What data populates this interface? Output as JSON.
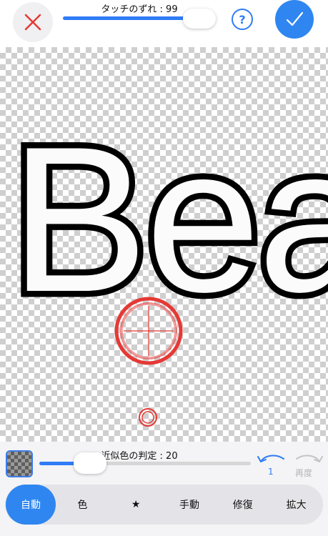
{
  "touch_offset": {
    "label": "タッチのずれ : 99",
    "value": 99,
    "max": 100
  },
  "help_label": "?",
  "canvas": {
    "text": "Bea"
  },
  "similarity": {
    "label": "近似色の判定 : 20",
    "value": 20,
    "max": 100
  },
  "history": {
    "undo_count": "1",
    "redo_label": "再度"
  },
  "tabs": [
    {
      "label": "自動",
      "active": true
    },
    {
      "label": "色",
      "active": false
    },
    {
      "label": "★",
      "active": false
    },
    {
      "label": "手動",
      "active": false
    },
    {
      "label": "修復",
      "active": false
    },
    {
      "label": "拡大",
      "active": false
    }
  ],
  "colors": {
    "accent": "#2f86f0",
    "crosshair": "#e53935",
    "close": "#e53935"
  }
}
